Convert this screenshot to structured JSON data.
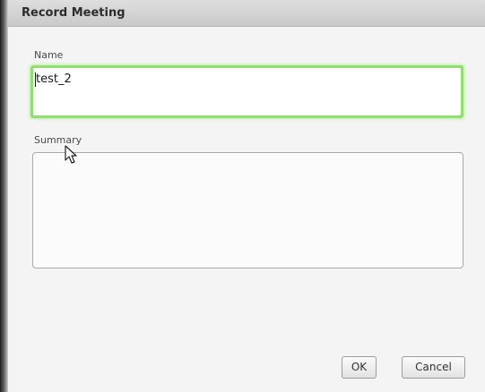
{
  "dialog": {
    "title": "Record Meeting"
  },
  "form": {
    "name_label": "Name",
    "name_value": "test_2",
    "summary_label": "Summary",
    "summary_value": ""
  },
  "buttons": {
    "ok_label": "OK",
    "cancel_label": "Cancel"
  },
  "colors": {
    "focus_border": "#90e070",
    "titlebar": "#d3d3d3"
  },
  "icons": {
    "cursor": "mouse-pointer-icon"
  }
}
